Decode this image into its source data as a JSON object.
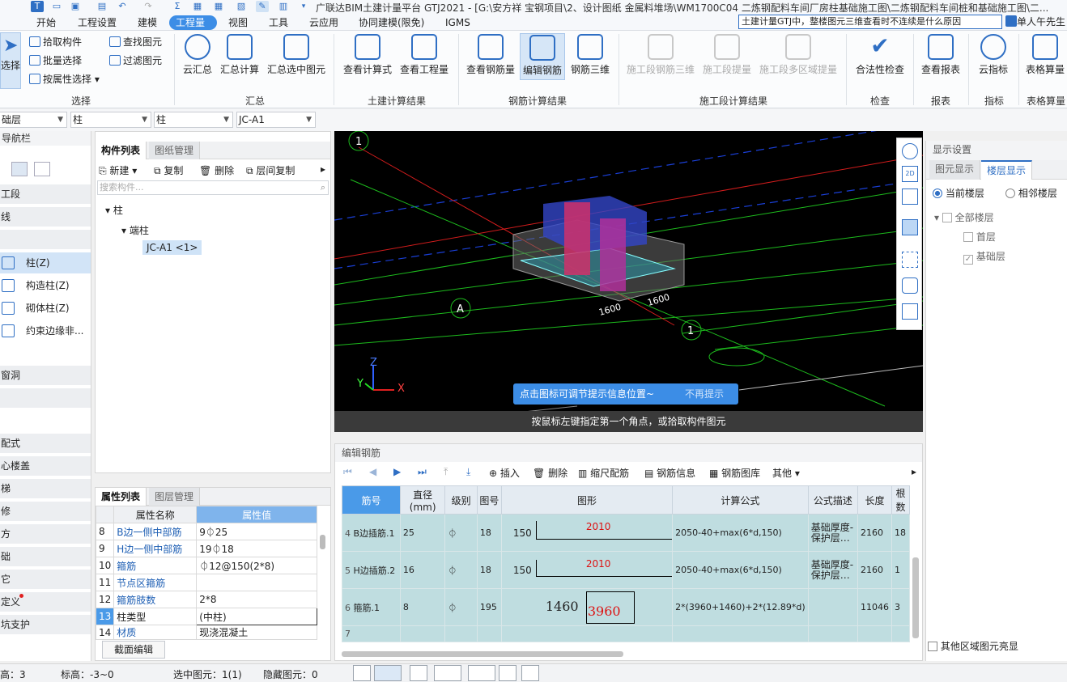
{
  "title_bar": {
    "title": "广联达BIM土建计量平台 GTJ2021 - [G:\\安方祥 宝钢项目\\2、设计图纸 金属料堆场\\WM1700C04 二炼钢配料车间厂房柱基础施工图\\二炼钢配料车间桩和基础施工图\\二..."
  },
  "menu": {
    "items": [
      "开始",
      "工程设置",
      "建模",
      "工程量",
      "视图",
      "工具",
      "云应用",
      "协同建模(限免)",
      "IGMS"
    ],
    "active": "工程量",
    "help_search": "土建计量GTJ中，整楼图元三维查看时不连续是什么原因",
    "user": "单人午先生"
  },
  "ribbon": {
    "select_group": {
      "label": "选择",
      "big": "选择",
      "pick": "拾取构件",
      "batch": "批量选择",
      "by_attr": "按属性选择",
      "find": "查找图元",
      "filter": "过滤图元"
    },
    "sum_group": {
      "label": "汇总",
      "cloud_sum": "云汇总",
      "sum_calc": "汇总计算",
      "sum_selected": "汇总选中图元"
    },
    "civil_group": {
      "label": "土建计算结果",
      "view_formula": "查看计算式",
      "view_quantity": "查看工程量"
    },
    "rebar_group": {
      "label": "钢筋计算结果",
      "view_rebar": "查看钢筋量",
      "edit_rebar": "编辑钢筋",
      "rebar_3d": "钢筋三维"
    },
    "stage_group": {
      "label": "施工段计算结果",
      "s1": "施工段钢筋三维",
      "s2": "施工段提量",
      "s3": "施工段多区域提量"
    },
    "check_group": {
      "label": "检查",
      "legality": "合法性检查"
    },
    "report_group": {
      "label": "报表",
      "view_report": "查看报表"
    },
    "index_group": {
      "label": "指标",
      "cloud_index": "云指标"
    },
    "table_group": {
      "label": "表格算量",
      "table_calc": "表格算量"
    }
  },
  "dropdowns": [
    "础层",
    "柱",
    "柱",
    "JC-A1"
  ],
  "nav": {
    "header": "导航栏",
    "sections": [
      "工段",
      "线",
      "",
      "窗洞",
      "",
      "配式",
      "心楼盖",
      "梯",
      "修",
      "方",
      "础",
      "它",
      "定义",
      "坑支护"
    ],
    "items": [
      "柱(Z)",
      "构造柱(Z)",
      "砌体柱(Z)",
      "约束边缘非..."
    ]
  },
  "component_panel": {
    "tabs": [
      "构件列表",
      "图纸管理"
    ],
    "tools": {
      "new": "新建",
      "copy": "复制",
      "delete": "删除",
      "floor_copy": "层间复制"
    },
    "search_placeholder": "搜索构件...",
    "tree": {
      "root": "柱",
      "child": "端柱",
      "leaf": "JC-A1 <1>"
    }
  },
  "property_panel": {
    "tabs": [
      "属性列表",
      "图层管理"
    ],
    "headers": {
      "name": "属性名称",
      "value": "属性值"
    },
    "rows": [
      {
        "no": "8",
        "name": "B边一侧中部筋",
        "value": "9⏀25"
      },
      {
        "no": "9",
        "name": "H边一侧中部筋",
        "value": "19⏀18"
      },
      {
        "no": "10",
        "name": "箍筋",
        "value": "⏀12@150(2*8)"
      },
      {
        "no": "11",
        "name": "节点区箍筋",
        "value": ""
      },
      {
        "no": "12",
        "name": "箍筋肢数",
        "value": "2*8"
      },
      {
        "no": "13",
        "name": "柱类型",
        "value": "(中柱)"
      },
      {
        "no": "14",
        "name": "材质",
        "value": "现浇混凝土"
      }
    ],
    "section_edit": "截面编辑"
  },
  "viewport": {
    "axis_labels": [
      "1",
      "A",
      "1"
    ],
    "dims": [
      "1600",
      "1600"
    ],
    "tooltip": "点击图标可调节提示信息位置~",
    "tooltip_dismiss": "不再提示",
    "hint": "按鼠标左键指定第一个角点，或拾取构件图元"
  },
  "display_settings": {
    "title": "显示设置",
    "tabs": [
      "图元显示",
      "楼层显示"
    ],
    "radio_current": "当前楼层",
    "radio_adjacent": "相邻楼层",
    "tree": {
      "all": "全部楼层",
      "first": "首层",
      "base": "基础层"
    },
    "bottom_check": "其他区域图元亮显"
  },
  "rebar_editor": {
    "title": "编辑钢筋",
    "tools": {
      "insert": "插入",
      "delete": "删除",
      "scale": "缩尺配筋",
      "info": "钢筋信息",
      "library": "钢筋图库",
      "other": "其他"
    },
    "headers": [
      "筋号",
      "直径(mm)",
      "级别",
      "图号",
      "图形",
      "计算公式",
      "公式描述",
      "长度",
      "根数"
    ],
    "rows": [
      {
        "no": "4",
        "name": "B边插筋.1",
        "dia": "25",
        "grade": "⏀",
        "fig": "18",
        "shape_a": "150",
        "shape_b": "2010",
        "formula": "2050-40+max(6*d,150)",
        "desc": "基础厚度-保护层…",
        "len": "2160",
        "count": "18"
      },
      {
        "no": "5",
        "name": "H边插筋.2",
        "dia": "16",
        "grade": "⏀",
        "fig": "18",
        "shape_a": "150",
        "shape_b": "2010",
        "formula": "2050-40+max(6*d,150)",
        "desc": "基础厚度-保护层…",
        "len": "2160",
        "count": "1"
      },
      {
        "no": "6",
        "name": "箍筋.1",
        "dia": "8",
        "grade": "⏀",
        "fig": "195",
        "shape_a": "1460",
        "shape_b": "3960",
        "formula": "2*(3960+1460)+2*(12.89*d)",
        "desc": "",
        "len": "11046",
        "count": "3"
      },
      {
        "no": "7",
        "name": "",
        "dia": "",
        "grade": "",
        "fig": "",
        "shape_a": "",
        "shape_b": "",
        "formula": "",
        "desc": "",
        "len": "",
        "count": ""
      }
    ]
  },
  "status": {
    "floor_height": "高：3",
    "elevation": "标高：-3~0",
    "selected": "选中图元：1(1)",
    "hidden": "隐藏图元：0"
  }
}
